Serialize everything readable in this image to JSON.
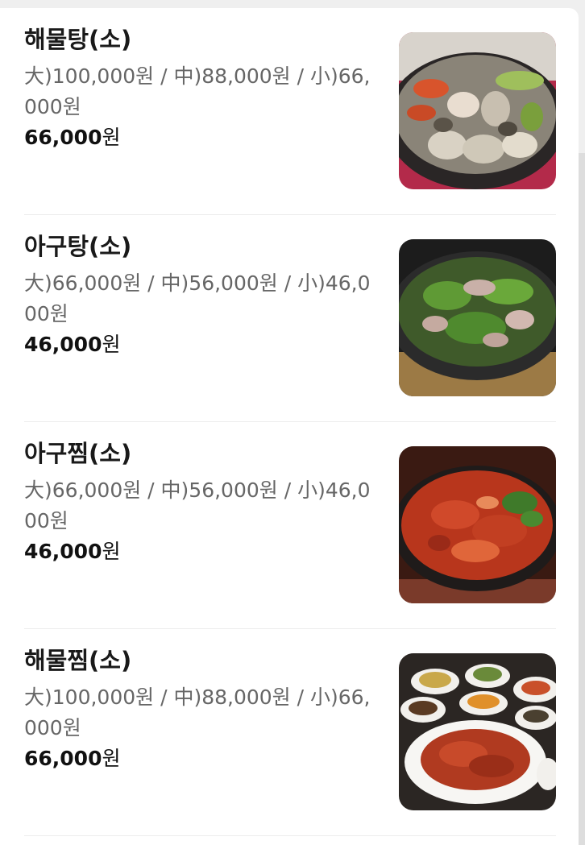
{
  "menu": {
    "items": [
      {
        "name": "해물탕(소)",
        "description": "大)100,000원 / 中)88,000원 / 小)66,000원",
        "price_number": "66,000",
        "price_unit": "원",
        "image": "seafood-stew-photo"
      },
      {
        "name": "아구탕(소)",
        "description": "大)66,000원 / 中)56,000원 / 小)46,000원",
        "price_number": "46,000",
        "price_unit": "원",
        "image": "monkfish-stew-photo"
      },
      {
        "name": "아구찜(소)",
        "description": "大)66,000원 / 中)56,000원 / 小)46,000원",
        "price_number": "46,000",
        "price_unit": "원",
        "image": "braised-monkfish-photo"
      },
      {
        "name": "해물찜(소)",
        "description": "大)100,000원 / 中)88,000원 / 小)66,000원",
        "price_number": "66,000",
        "price_unit": "원",
        "image": "braised-seafood-photo"
      }
    ]
  },
  "colors": {
    "title": "#1a1a1a",
    "description": "#666666",
    "divider": "#ececec"
  }
}
